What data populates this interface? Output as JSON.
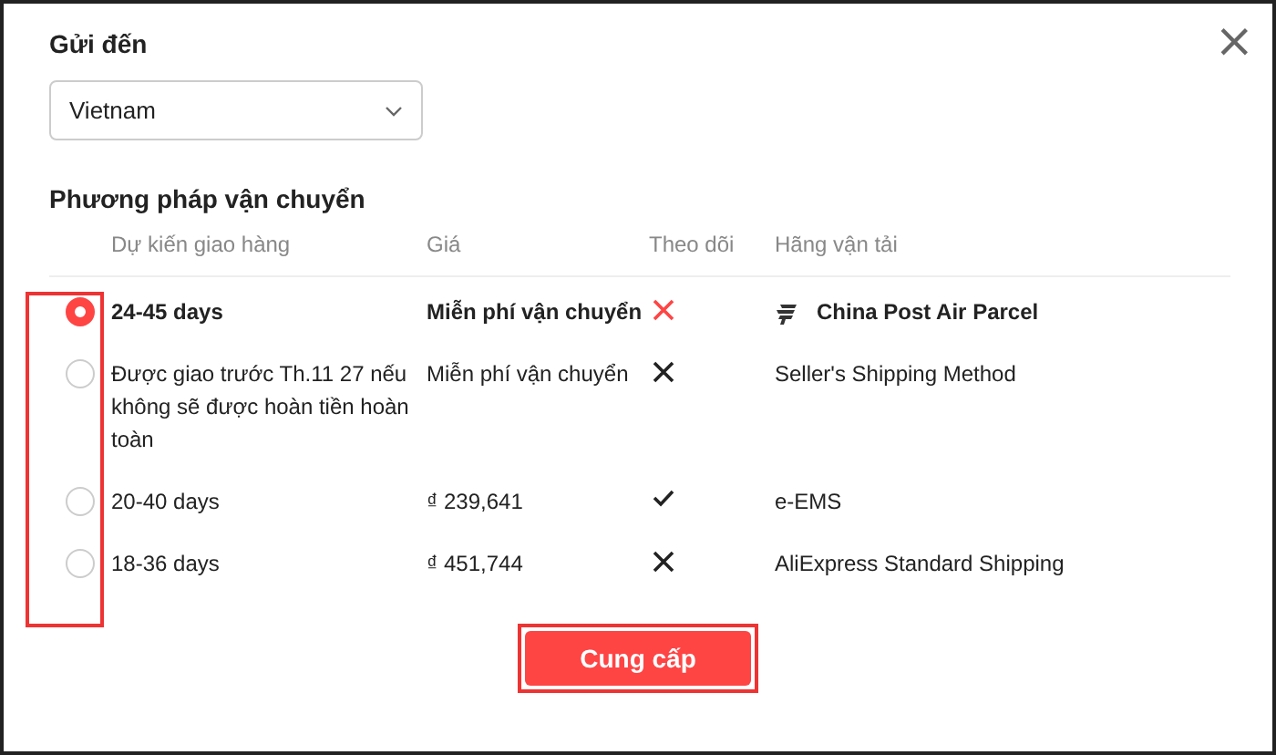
{
  "dialog": {
    "close": "×"
  },
  "destination": {
    "label": "Gửi đến",
    "value": "Vietnam"
  },
  "shipping": {
    "title": "Phương pháp vận chuyển",
    "columns": [
      "Dự kiến giao hàng",
      "Giá",
      "Theo dõi",
      "Hãng vận tải"
    ],
    "rows": [
      {
        "selected": true,
        "delivery": "24-45 days",
        "price": "Miễn phí vận chuyển",
        "tracked": false,
        "carrier": "China Post Air Parcel",
        "carrier_logo": true
      },
      {
        "selected": false,
        "delivery": "Được giao trước Th.11 27 nếu không sẽ được hoàn tiền hoàn toàn",
        "price": "Miễn phí vận chuyển",
        "tracked": false,
        "carrier": "Seller's Shipping Method",
        "carrier_logo": false
      },
      {
        "selected": false,
        "delivery": "20-40 days",
        "price": "₫ 239,641",
        "tracked": true,
        "carrier": "e-EMS",
        "carrier_logo": false
      },
      {
        "selected": false,
        "delivery": "18-36 days",
        "price": "₫ 451,744",
        "tracked": false,
        "carrier": "AliExpress Standard Shipping",
        "carrier_logo": false
      }
    ]
  },
  "submit": "Cung cấp"
}
